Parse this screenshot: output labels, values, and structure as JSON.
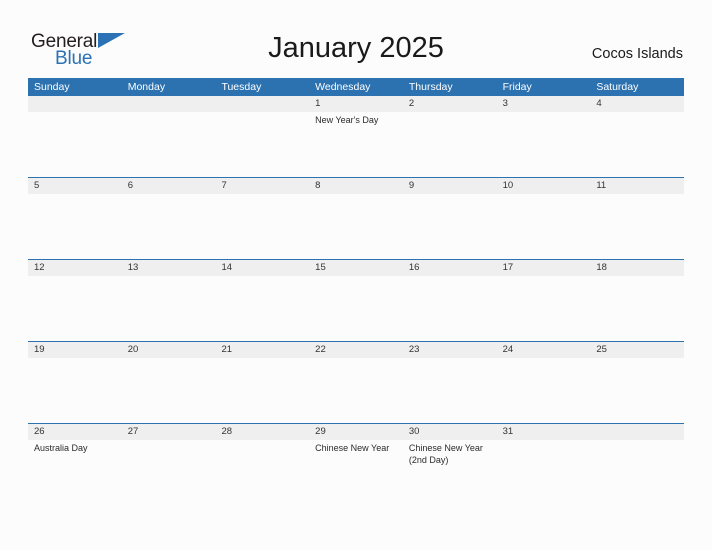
{
  "brand": {
    "name_part1": "General",
    "name_part2": "Blue"
  },
  "header": {
    "title": "January 2025",
    "location": "Cocos Islands"
  },
  "colors": {
    "header_blue": "#2c71b0",
    "date_band_gray": "#efefef",
    "page_background": "#fcfcfc",
    "logo_blue": "#2a72b5",
    "text_dark": "#1a1a1a"
  },
  "calendar": {
    "weekdays": [
      "Sunday",
      "Monday",
      "Tuesday",
      "Wednesday",
      "Thursday",
      "Friday",
      "Saturday"
    ],
    "weeks": [
      {
        "dates": [
          "",
          "",
          "",
          "1",
          "2",
          "3",
          "4"
        ],
        "events": [
          [],
          [],
          [],
          [
            "New Year's Day"
          ],
          [],
          [],
          []
        ]
      },
      {
        "dates": [
          "5",
          "6",
          "7",
          "8",
          "9",
          "10",
          "11"
        ],
        "events": [
          [],
          [],
          [],
          [],
          [],
          [],
          []
        ]
      },
      {
        "dates": [
          "12",
          "13",
          "14",
          "15",
          "16",
          "17",
          "18"
        ],
        "events": [
          [],
          [],
          [],
          [],
          [],
          [],
          []
        ]
      },
      {
        "dates": [
          "19",
          "20",
          "21",
          "22",
          "23",
          "24",
          "25"
        ],
        "events": [
          [],
          [],
          [],
          [],
          [],
          [],
          []
        ]
      },
      {
        "dates": [
          "26",
          "27",
          "28",
          "29",
          "30",
          "31",
          ""
        ],
        "events": [
          [
            "Australia Day"
          ],
          [],
          [],
          [
            "Chinese New Year"
          ],
          [
            "Chinese New Year (2nd Day)"
          ],
          [],
          []
        ]
      }
    ]
  }
}
